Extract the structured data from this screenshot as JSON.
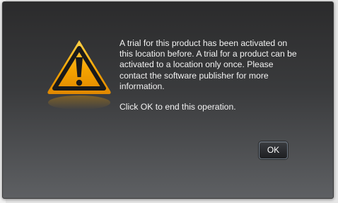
{
  "dialog": {
    "icon": "warning-triangle-icon",
    "message": "A trial for this product has been activated on this location before. A trial for a product can be activated to a location only once. Please contact the software publisher for more information.",
    "instruction": "Click OK to end this operation.",
    "ok_label": "OK"
  },
  "colors": {
    "icon_fill": "#f5a300",
    "icon_border": "#1a1a1a",
    "text": "#f2f2f2",
    "dialog_top": "#2b2b2c",
    "dialog_bottom": "#5e6063"
  }
}
